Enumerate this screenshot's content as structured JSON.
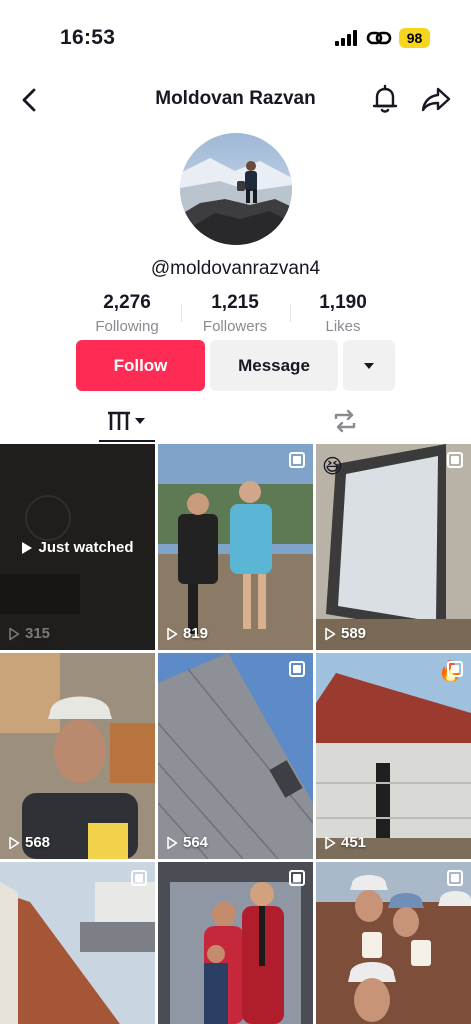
{
  "status_bar": {
    "time": "16:53",
    "battery": "98"
  },
  "header": {
    "title": "Moldovan Razvan"
  },
  "profile": {
    "username": "@moldovanrazvan4",
    "stats": [
      {
        "value": "2,276",
        "label": "Following"
      },
      {
        "value": "1,215",
        "label": "Followers"
      },
      {
        "value": "1,190",
        "label": "Likes"
      }
    ]
  },
  "actions": {
    "follow_label": "Follow",
    "message_label": "Message"
  },
  "grid": {
    "just_watched_label": "Just watched",
    "tiles": [
      {
        "views": "315"
      },
      {
        "views": "819"
      },
      {
        "views": "589",
        "emoji": "😆"
      },
      {
        "views": "568"
      },
      {
        "views": "564"
      },
      {
        "views": "451",
        "emoji": "🔥"
      },
      {
        "views": ""
      },
      {
        "views": ""
      },
      {
        "views": ""
      }
    ]
  },
  "colors": {
    "accent": "#fe2c55",
    "button_grey": "#f1f1f2",
    "battery": "#f7d51c"
  }
}
